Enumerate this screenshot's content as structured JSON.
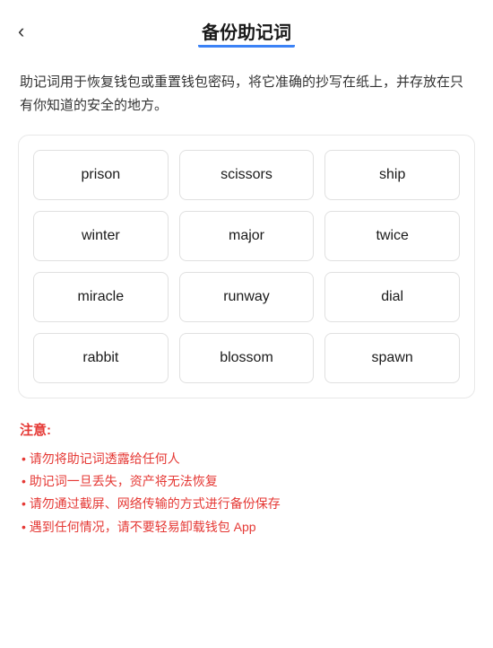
{
  "header": {
    "back_icon": "←",
    "title": "备份助记词"
  },
  "description": "助记词用于恢复钱包或重置钱包密码，将它准确的抄写在纸上，并存放在只有你知道的安全的地方。",
  "mnemonic_grid": {
    "words": [
      {
        "text": "prison"
      },
      {
        "text": "scissors"
      },
      {
        "text": "ship"
      },
      {
        "text": "winter"
      },
      {
        "text": "major"
      },
      {
        "text": "twice"
      },
      {
        "text": "miracle"
      },
      {
        "text": "runway"
      },
      {
        "text": "dial"
      },
      {
        "text": "rabbit"
      },
      {
        "text": "blossom"
      },
      {
        "text": "spawn"
      }
    ]
  },
  "notice": {
    "title": "注意:",
    "items": [
      "请勿将助记词透露给任何人",
      "助记词一旦丢失，资产将无法恢复",
      "请勿通过截屏、网络传输的方式进行备份保存",
      "遇到任何情况，请不要轻易卸载钱包 App"
    ]
  }
}
